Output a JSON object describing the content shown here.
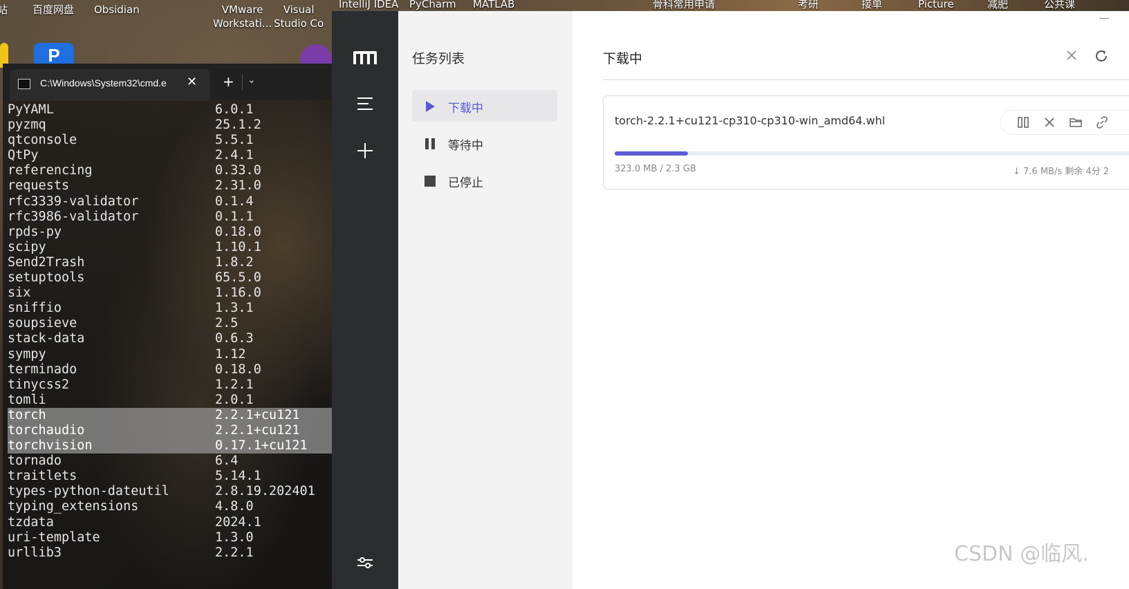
{
  "desktop": {
    "labels": [
      {
        "text": "站",
        "x_hint": "edge"
      },
      {
        "text": "百度网盘"
      },
      {
        "text": "Obsidian"
      },
      {
        "text": "VMware\nWorkstati..."
      },
      {
        "text": "Visual\nStudio Co"
      },
      {
        "text": "IntelliJ IDEA"
      },
      {
        "text": "PyCharm"
      },
      {
        "text": "MATLAB"
      },
      {
        "text": "骨科常用申请"
      },
      {
        "text": "考研"
      },
      {
        "text": "接单"
      },
      {
        "text": "Picture"
      },
      {
        "text": "减肥"
      },
      {
        "text": "公共课"
      }
    ],
    "icon_letter": "P"
  },
  "terminal": {
    "tab_title": "C:\\Windows\\System32\\cmd.e",
    "close_glyph": "✕",
    "new_tab_glyph": "+",
    "dropdown_glyph": "⌄",
    "packages": [
      {
        "name": "PyYAML",
        "version": "6.0.1",
        "highlighted": false
      },
      {
        "name": "pyzmq",
        "version": "25.1.2",
        "highlighted": false
      },
      {
        "name": "qtconsole",
        "version": "5.5.1",
        "highlighted": false
      },
      {
        "name": "QtPy",
        "version": "2.4.1",
        "highlighted": false
      },
      {
        "name": "referencing",
        "version": "0.33.0",
        "highlighted": false
      },
      {
        "name": "requests",
        "version": "2.31.0",
        "highlighted": false
      },
      {
        "name": "rfc3339-validator",
        "version": "0.1.4",
        "highlighted": false
      },
      {
        "name": "rfc3986-validator",
        "version": "0.1.1",
        "highlighted": false
      },
      {
        "name": "rpds-py",
        "version": "0.18.0",
        "highlighted": false
      },
      {
        "name": "scipy",
        "version": "1.10.1",
        "highlighted": false
      },
      {
        "name": "Send2Trash",
        "version": "1.8.2",
        "highlighted": false
      },
      {
        "name": "setuptools",
        "version": "65.5.0",
        "highlighted": false
      },
      {
        "name": "six",
        "version": "1.16.0",
        "highlighted": false
      },
      {
        "name": "sniffio",
        "version": "1.3.1",
        "highlighted": false
      },
      {
        "name": "soupsieve",
        "version": "2.5",
        "highlighted": false
      },
      {
        "name": "stack-data",
        "version": "0.6.3",
        "highlighted": false
      },
      {
        "name": "sympy",
        "version": "1.12",
        "highlighted": false
      },
      {
        "name": "terminado",
        "version": "0.18.0",
        "highlighted": false
      },
      {
        "name": "tinycss2",
        "version": "1.2.1",
        "highlighted": false
      },
      {
        "name": "tomli",
        "version": "2.0.1",
        "highlighted": false
      },
      {
        "name": "torch",
        "version": "2.2.1+cu121",
        "highlighted": true
      },
      {
        "name": "torchaudio",
        "version": "2.2.1+cu121",
        "highlighted": true
      },
      {
        "name": "torchvision",
        "version": "0.17.1+cu121",
        "highlighted": true
      },
      {
        "name": "tornado",
        "version": "6.4",
        "highlighted": false
      },
      {
        "name": "traitlets",
        "version": "5.14.1",
        "highlighted": false
      },
      {
        "name": "types-python-dateutil",
        "version": "2.8.19.202401",
        "highlighted": false
      },
      {
        "name": "typing_extensions",
        "version": "4.8.0",
        "highlighted": false
      },
      {
        "name": "tzdata",
        "version": "2024.1",
        "highlighted": false
      },
      {
        "name": "uri-template",
        "version": "1.3.0",
        "highlighted": false
      },
      {
        "name": "urllib3",
        "version": "2.2.1",
        "highlighted": false
      }
    ]
  },
  "app": {
    "sidebar_icons": [
      "motrix-logo-icon",
      "menu-icon",
      "add-icon",
      "settings-icon"
    ],
    "nav": {
      "title": "任务列表",
      "items": [
        {
          "label": "下载中",
          "icon": "play-icon",
          "active": true
        },
        {
          "label": "等待中",
          "icon": "pause-icon",
          "active": false
        },
        {
          "label": "已停止",
          "icon": "stop-icon",
          "active": false
        }
      ]
    },
    "main": {
      "title": "下载中",
      "task": {
        "file_name": "torch-2.2.1+cu121-cp310-cp310-win_amd64.whl",
        "size_text": "323.0 MB / 2.3 GB",
        "speed_text": "↓ 7.6 MB/s  剩余 4分 2",
        "progress": 0.14
      }
    },
    "accent_color": "#5b5bd6"
  },
  "watermark": "CSDN @临风."
}
